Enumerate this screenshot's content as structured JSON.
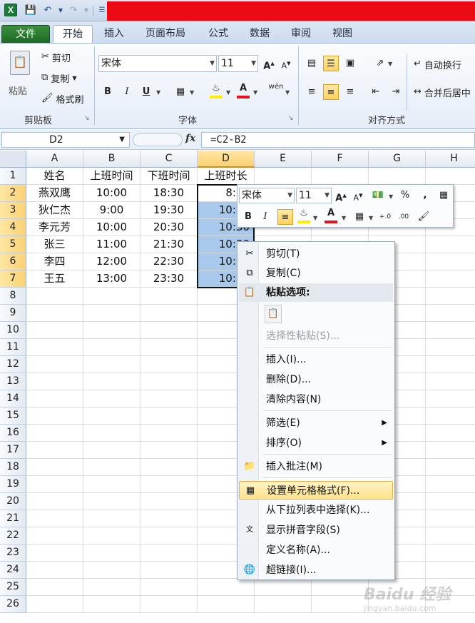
{
  "titlebar": {
    "logo": "X"
  },
  "tabs": [
    "文件",
    "开始",
    "插入",
    "页面布局",
    "公式",
    "数据",
    "审阅",
    "视图"
  ],
  "ribbon": {
    "clipboard": {
      "paste": "粘贴",
      "cut": "剪切",
      "copy": "复制",
      "format_painter": "格式刷",
      "label": "剪贴板"
    },
    "font": {
      "name": "宋体",
      "size": "11",
      "label": "字体",
      "bold": "B",
      "italic": "I",
      "underline": "U",
      "phonetic": "wén"
    },
    "alignment": {
      "wrap": "自动换行",
      "merge": "合并后居中",
      "label": "对齐方式"
    }
  },
  "formula_bar": {
    "name_box": "D2",
    "fx": "fx",
    "formula": "=C2-B2"
  },
  "sheet": {
    "columns": [
      "A",
      "B",
      "C",
      "D",
      "E",
      "F",
      "G",
      "H"
    ],
    "selected_column": "D",
    "rows": [
      "1",
      "2",
      "3",
      "4",
      "5",
      "6",
      "7",
      "8",
      "9",
      "10",
      "11",
      "12",
      "13",
      "14",
      "15",
      "16",
      "17",
      "18",
      "19",
      "20",
      "21",
      "22",
      "23",
      "24",
      "25",
      "26"
    ],
    "selected_rows": [
      "2",
      "3",
      "4",
      "5",
      "6",
      "7"
    ],
    "headers": [
      "姓名",
      "上班时间",
      "下班时间",
      "上班时长"
    ],
    "data": [
      [
        "燕双鹰",
        "10:00",
        "18:30",
        "8:30"
      ],
      [
        "狄仁杰",
        "9:00",
        "19:30",
        "10:30"
      ],
      [
        "李元芳",
        "10:00",
        "20:30",
        "10:30"
      ],
      [
        "张三",
        "11:00",
        "21:30",
        "10:30"
      ],
      [
        "李四",
        "12:00",
        "22:30",
        "10:30"
      ],
      [
        "王五",
        "13:00",
        "23:30",
        "10:30"
      ]
    ]
  },
  "minibar": {
    "font": "宋体",
    "size": "11",
    "percent": "%",
    "comma": ",",
    "bold": "B",
    "italic": "I",
    "dec_inc": "+.0",
    "dec_dec": ".00"
  },
  "context_menu": {
    "cut": "剪切(T)",
    "copy": "复制(C)",
    "paste_options": "粘贴选项:",
    "paste_special": "选择性粘贴(S)...",
    "insert": "插入(I)...",
    "delete": "删除(D)...",
    "clear": "清除内容(N)",
    "filter": "筛选(E)",
    "sort": "排序(O)",
    "insert_comment": "插入批注(M)",
    "format_cells": "设置单元格格式(F)...",
    "pick_list": "从下拉列表中选择(K)...",
    "phonetic": "显示拼音字段(S)",
    "define_name": "定义名称(A)...",
    "hyperlink": "超链接(I)..."
  },
  "watermark": {
    "main": "Baidu 经验",
    "sub": "jingyan.baidu.com"
  }
}
